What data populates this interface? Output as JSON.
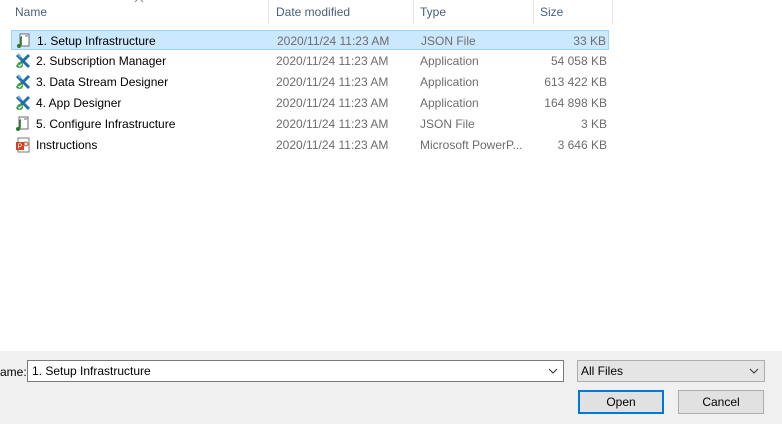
{
  "columns": {
    "name": "Name",
    "date": "Date modified",
    "type": "Type",
    "size": "Size"
  },
  "files": [
    {
      "name": "1. Setup Infrastructure",
      "date": "2020/11/24 11:23 AM",
      "type": "JSON File",
      "size": "33 KB",
      "icon": "json-file-icon",
      "selected": true
    },
    {
      "name": "2. Subscription Manager",
      "date": "2020/11/24 11:23 AM",
      "type": "Application",
      "size": "54 058 KB",
      "icon": "application-icon"
    },
    {
      "name": "3. Data Stream Designer",
      "date": "2020/11/24 11:23 AM",
      "type": "Application",
      "size": "613 422 KB",
      "icon": "application-icon"
    },
    {
      "name": "4. App Designer",
      "date": "2020/11/24 11:23 AM",
      "type": "Application",
      "size": "164 898 KB",
      "icon": "application-icon"
    },
    {
      "name": "5. Configure Infrastructure",
      "date": "2020/11/24 11:23 AM",
      "type": "JSON File",
      "size": "3 KB",
      "icon": "json-file-icon"
    },
    {
      "name": "Instructions",
      "date": "2020/11/24 11:23 AM",
      "type": "Microsoft PowerP...",
      "size": "3 646 KB",
      "icon": "powerpoint-file-icon"
    }
  ],
  "footer": {
    "filename_label": "ame:",
    "filename_value": "1. Setup Infrastructure",
    "filter_value": "All Files",
    "open_label": "Open",
    "cancel_label": "Cancel"
  },
  "colors": {
    "selection_bg": "#cce8ff",
    "selection_border": "#99d1ff",
    "header_text": "#4c607a",
    "accent": "#0078d7"
  }
}
